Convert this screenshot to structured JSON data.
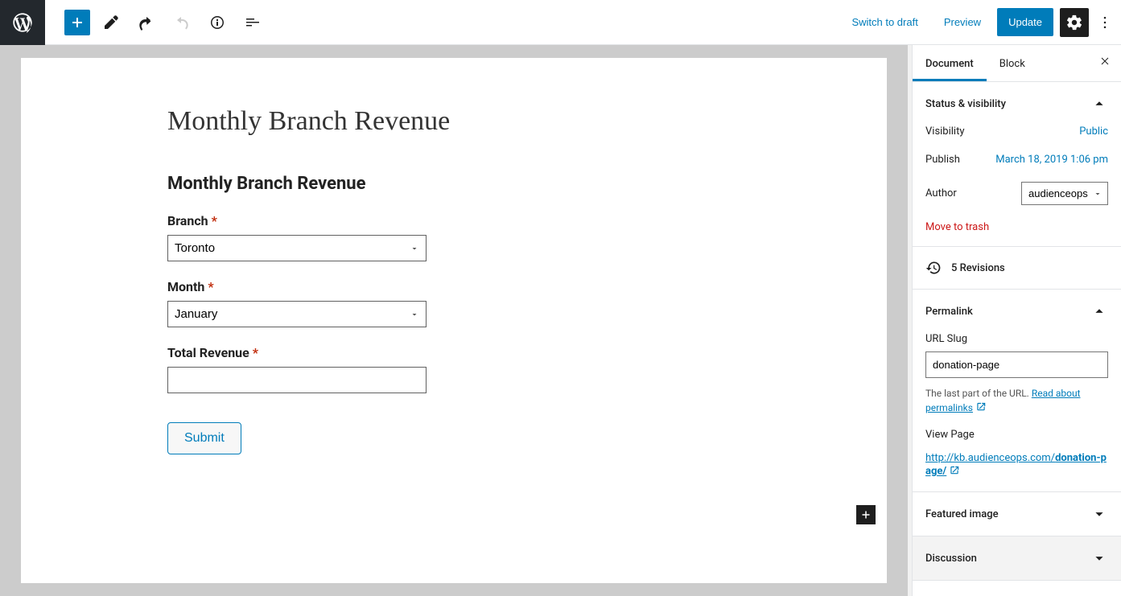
{
  "toolbar": {
    "switch_draft": "Switch to draft",
    "preview": "Preview",
    "update": "Update"
  },
  "page": {
    "title": "Monthly Branch Revenue",
    "form_title": "Monthly Branch Revenue",
    "branch_label": "Branch",
    "branch_value": "Toronto",
    "month_label": "Month",
    "month_value": "January",
    "revenue_label": "Total Revenue",
    "revenue_value": "",
    "submit": "Submit"
  },
  "sidebar": {
    "tab_document": "Document",
    "tab_block": "Block",
    "status": {
      "heading": "Status & visibility",
      "visibility_label": "Visibility",
      "visibility_value": "Public",
      "publish_label": "Publish",
      "publish_value": "March 18, 2019 1:06 pm",
      "author_label": "Author",
      "author_value": "audienceops",
      "trash": "Move to trash"
    },
    "revisions": "5 Revisions",
    "permalink": {
      "heading": "Permalink",
      "slug_label": "URL Slug",
      "slug_value": "donation-page",
      "help_prefix": "The last part of the URL. ",
      "help_link": "Read about permalinks",
      "view_page": "View Page",
      "url_base": "http://kb.audienceops.com/",
      "url_bold": "donation-page/"
    },
    "featured": "Featured image",
    "discussion": "Discussion"
  }
}
